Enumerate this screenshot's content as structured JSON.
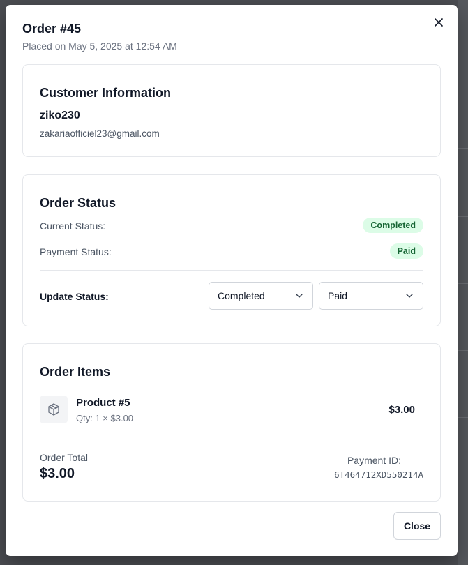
{
  "modal": {
    "title": "Order #45",
    "subtitle": "Placed on May 5, 2025 at 12:54 AM",
    "close_icon": "close-icon"
  },
  "customer": {
    "heading": "Customer Information",
    "name": "ziko230",
    "email": "zakariaofficiel23@gmail.com"
  },
  "status": {
    "heading": "Order Status",
    "current_label": "Current Status:",
    "current_value": "Completed",
    "payment_label": "Payment Status:",
    "payment_value": "Paid",
    "badge_bg": "#dcfce7",
    "badge_text_color": "#166534",
    "update_label": "Update Status:",
    "order_select_value": "Completed",
    "payment_select_value": "Paid"
  },
  "items": {
    "heading": "Order Items",
    "list": [
      {
        "name": "Product #5",
        "qty_line": "Qty: 1 × $3.00",
        "price": "$3.00",
        "icon": "package-icon"
      }
    ],
    "total_label": "Order Total",
    "total_value": "$3.00",
    "payment_id_label": "Payment ID:",
    "payment_id_value": "6T464712XD550214A"
  },
  "footer": {
    "close_label": "Close"
  }
}
